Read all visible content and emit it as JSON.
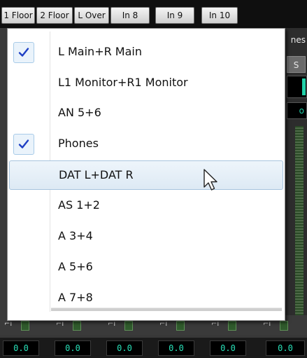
{
  "channel_tabs": [
    "1 Floor",
    "2 Floor",
    "L Over",
    "In 8",
    "In 9",
    "In 10"
  ],
  "right_panel": {
    "label": "nes",
    "button": "S",
    "readout": "o"
  },
  "menu": {
    "items": [
      {
        "label": "L Main+R Main",
        "checked": true,
        "icon": "checkmark-icon"
      },
      {
        "label": "L1 Monitor+R1 Monitor",
        "checked": false
      },
      {
        "label": "AN 5+6",
        "checked": false
      },
      {
        "label": "Phones",
        "checked": true,
        "icon": "checkmark-icon"
      },
      {
        "label": "DAT L+DAT R",
        "checked": false,
        "highlighted": true
      },
      {
        "label": "AS 1+2",
        "checked": false
      },
      {
        "label": "A 3+4",
        "checked": false
      },
      {
        "label": "A 5+6",
        "checked": false
      },
      {
        "label": "A 7+8",
        "checked": false
      }
    ]
  },
  "fader_values": [
    "0.0",
    "0.0",
    "0.0",
    "0.0",
    "0.0",
    "0.0"
  ],
  "colors": {
    "check": "#1e3fc4",
    "readout": "#29e0b8",
    "hover_border": "#a7c4de"
  },
  "cursor_icon": "mouse-pointer-icon"
}
